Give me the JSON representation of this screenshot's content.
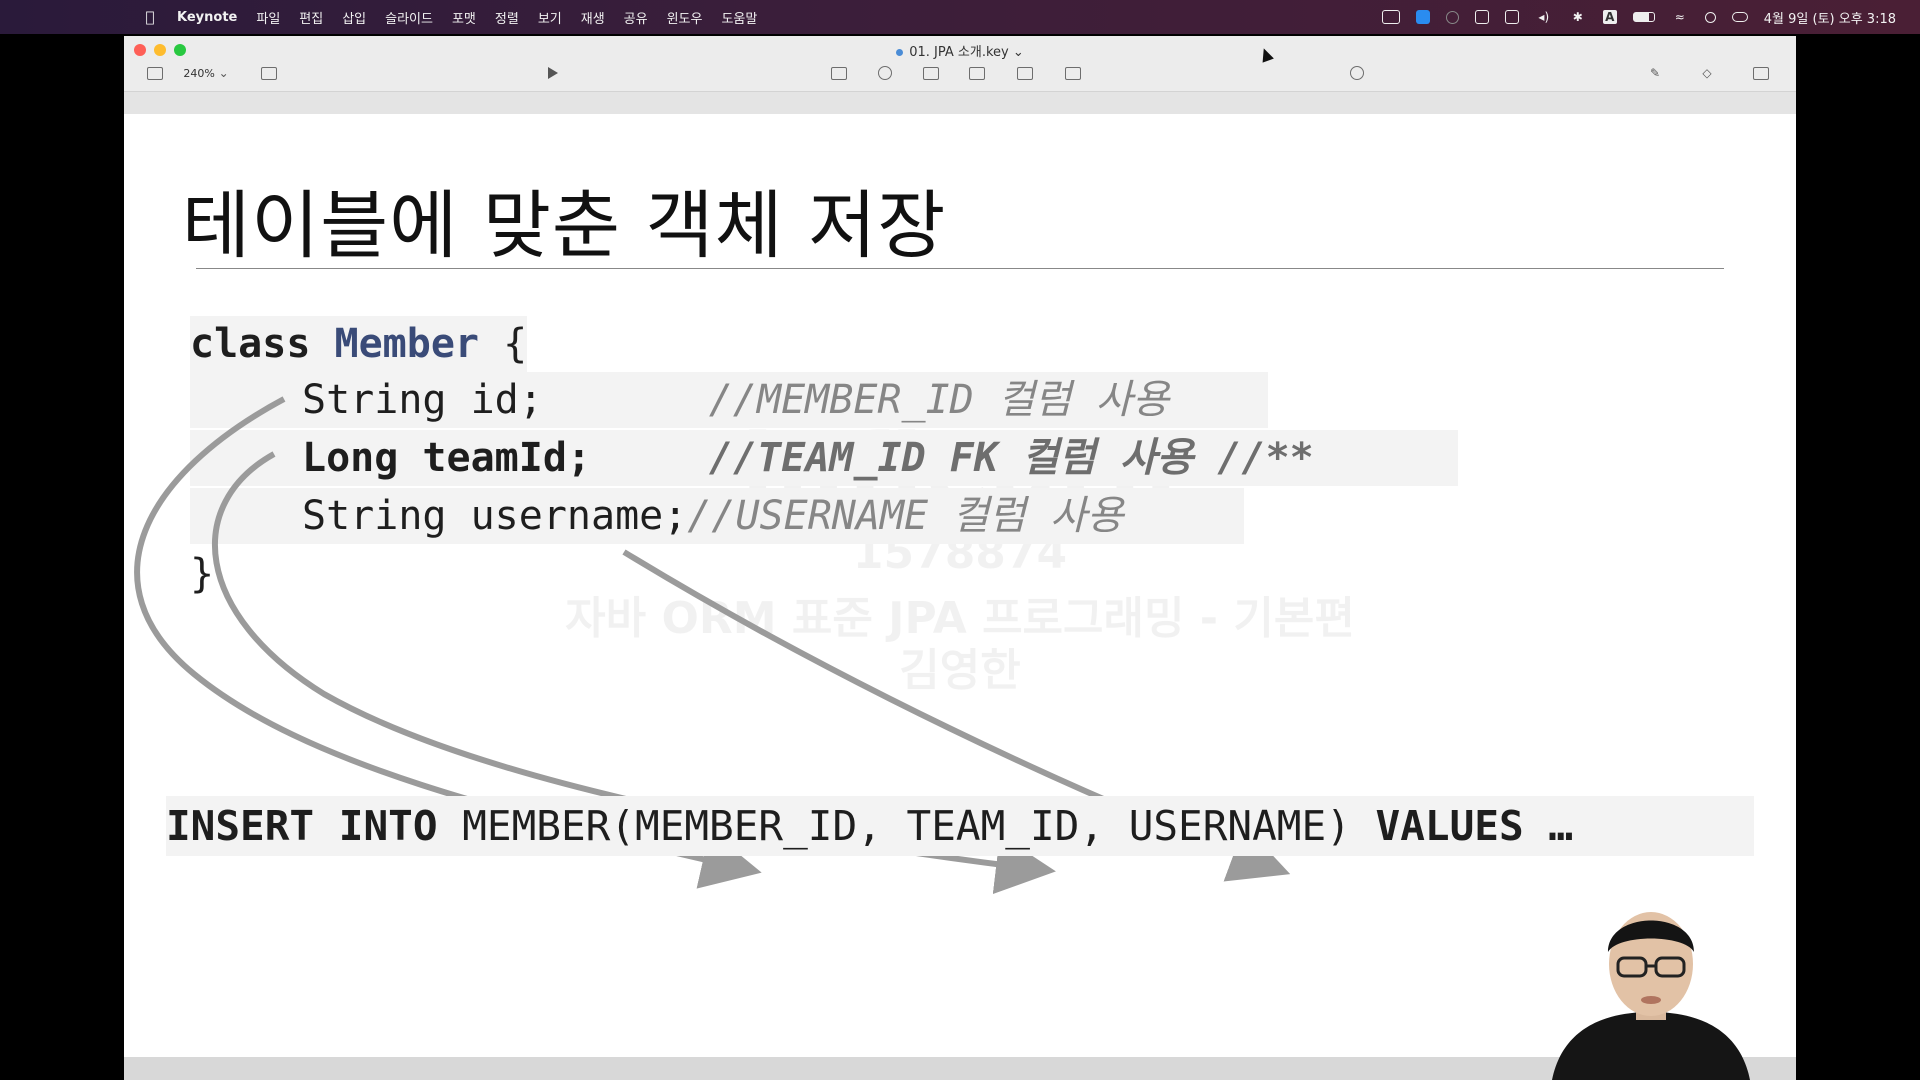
{
  "menubar": {
    "app_name": "Keynote",
    "menus": [
      "파일",
      "편집",
      "삽입",
      "슬라이드",
      "포맷",
      "정렬",
      "보기",
      "재생",
      "공유",
      "윈도우",
      "도움말"
    ],
    "clock": "4월 9일 (토) 오후 3:18",
    "status_icons": [
      "camera-icon",
      "app-icon",
      "globe-icon",
      "text-icon",
      "grid-icon",
      "volume-icon",
      "bluetooth-icon",
      "input-source-icon",
      "battery-icon",
      "wifi-icon",
      "spotlight-icon",
      "control-center-icon"
    ]
  },
  "window": {
    "doc_title": "01. JPA 소개.key",
    "zoom": "240%"
  },
  "slide": {
    "title": "테이블에 맞춘 객체 저장",
    "code": {
      "kw_class": "class",
      "class_name": "Member",
      "open_brace": "{",
      "line1_code": "String id;",
      "line1_comment": "//MEMBER_ID 컬럼 사용",
      "line2_code": "Long teamId;",
      "line2_comment": "//TEAM_ID FK 컬럼 사용 //**",
      "line3_code": "String username;",
      "line3_comment": "//USERNAME 컬럼 사용",
      "close_brace": "}"
    },
    "sql": {
      "kw_insert": "INSERT INTO",
      "body": "MEMBER(MEMBER_ID, TEAM_ID, USERNAME)",
      "kw_values": "VALUES",
      "ellipsis": "…"
    },
    "watermark": {
      "line1": "inflearn",
      "line2": "1578874",
      "line3": "자바 ORM 표준 JPA 프로그래밍 - 기본편",
      "line4": "김영한"
    }
  }
}
